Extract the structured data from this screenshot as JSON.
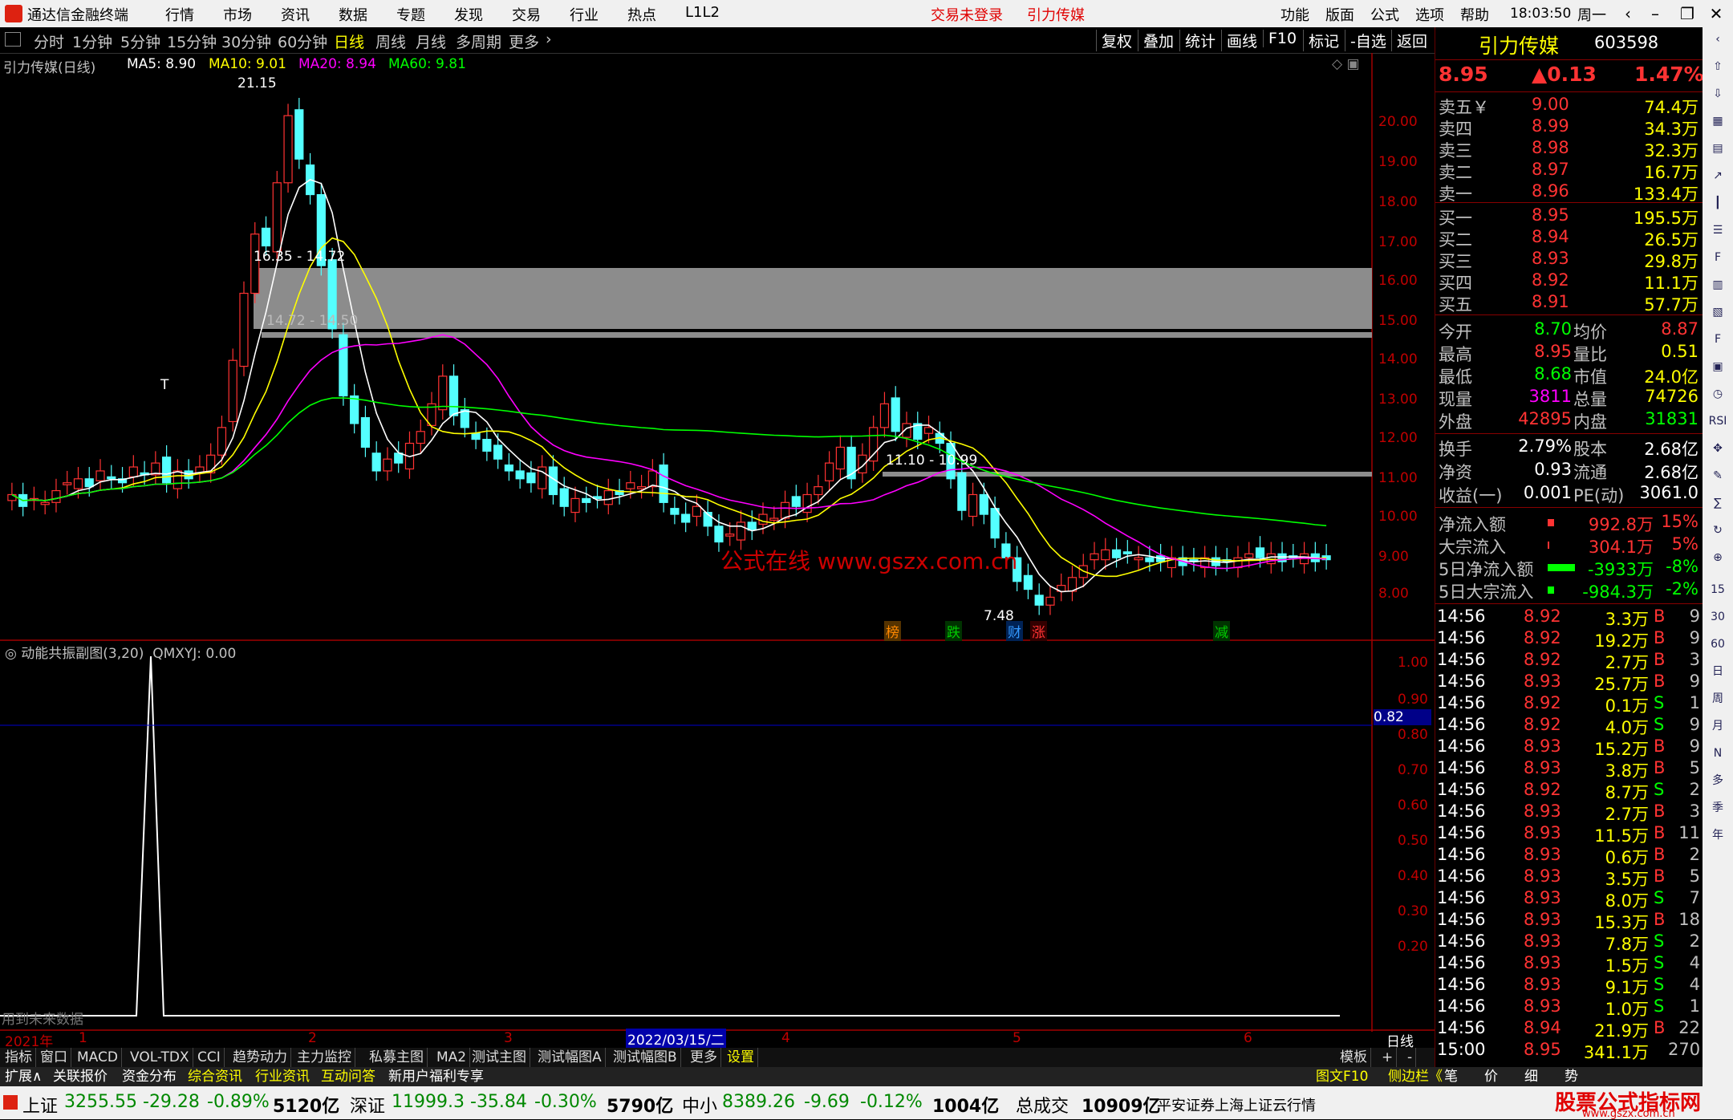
{
  "menubar": {
    "app_name": "通达信金融终端",
    "items": [
      "行情",
      "市场",
      "资讯",
      "数据",
      "专题",
      "发现",
      "交易",
      "行业",
      "热点",
      "L1L2"
    ],
    "login_status": "交易未登录",
    "stock_name_red": "引力传媒",
    "right_items": [
      "功能",
      "版面",
      "公式",
      "选项",
      "帮助"
    ],
    "time": "18:03:50",
    "weekday": "周一"
  },
  "toolbar": {
    "periods": [
      "分时",
      "1分钟",
      "5分钟",
      "15分钟",
      "30分钟",
      "60分钟",
      "日线",
      "周线",
      "月线",
      "多周期",
      "更多"
    ],
    "active_period": "日线",
    "right_buttons": [
      "复权",
      "叠加",
      "统计",
      "画线",
      "F10",
      "标记",
      "-自选",
      "返回"
    ]
  },
  "main_chart": {
    "title": "引力传媒(日线)",
    "ma": [
      {
        "label": "MA5: 8.90",
        "color": "#ffffff"
      },
      {
        "label": "MA10: 9.01",
        "color": "#ffff00"
      },
      {
        "label": "MA20: 8.94",
        "color": "#ff00ff"
      },
      {
        "label": "MA60: 9.81",
        "color": "#00ff00"
      }
    ],
    "y_ticks": [
      "20.00",
      "19.00",
      "18.00",
      "17.00",
      "16.00",
      "15.00",
      "14.00",
      "13.00",
      "12.00",
      "11.00",
      "10.00",
      "9.00",
      "8.00"
    ],
    "annotations": {
      "high": "21.15",
      "low": "7.48",
      "gap1": "16.35 - 14.72",
      "gap2": "14.72 - 14.50",
      "gap3": "11.10 - 10.99",
      "t_mark": "T"
    },
    "watermark": "公式在线   www.gszx.com.cn",
    "event_tags": [
      {
        "text": "榜",
        "color": "#ff8800"
      },
      {
        "text": "跌",
        "color": "#00cc00"
      },
      {
        "text": "财",
        "color": "#3399ff"
      },
      {
        "text": "涨",
        "color": "#ff3333"
      },
      {
        "text": "减",
        "color": "#00cc00"
      }
    ]
  },
  "sub_chart": {
    "title": "动能共振副图(3,20)",
    "value_label": "QMXYJ: 0.00",
    "y_ticks": [
      "1.00",
      "0.90",
      "0.80",
      "0.70",
      "0.60",
      "0.50",
      "0.40",
      "0.30",
      "0.20"
    ],
    "cursor_value": "0.82",
    "future_data_note": "用到未来数据"
  },
  "x_axis": {
    "labels": [
      "2021年",
      "1",
      "2",
      "3",
      "4",
      "5",
      "6"
    ],
    "date_box": "2022/03/15/二",
    "period_label": "日线"
  },
  "quote_panel": {
    "name": "引力传媒",
    "code": "603598",
    "price": "8.95",
    "change": "▲0.13",
    "change_pct": "1.47%",
    "asks": [
      {
        "label": "卖五￥",
        "price": "9.00",
        "vol": "74.4万"
      },
      {
        "label": "卖四",
        "price": "8.99",
        "vol": "34.3万"
      },
      {
        "label": "卖三",
        "price": "8.98",
        "vol": "32.3万"
      },
      {
        "label": "卖二",
        "price": "8.97",
        "vol": "16.7万"
      },
      {
        "label": "卖一",
        "price": "8.96",
        "vol": "133.4万"
      }
    ],
    "bids": [
      {
        "label": "买一",
        "price": "8.95",
        "vol": "195.5万"
      },
      {
        "label": "买二",
        "price": "8.94",
        "vol": "26.5万"
      },
      {
        "label": "买三",
        "price": "8.93",
        "vol": "29.8万"
      },
      {
        "label": "买四",
        "price": "8.92",
        "vol": "11.1万"
      },
      {
        "label": "买五",
        "price": "8.91",
        "vol": "57.7万"
      }
    ],
    "stats": [
      {
        "l1": "今开",
        "v1": "8.70",
        "c1": "#00ff00",
        "l2": "均价",
        "v2": "8.87",
        "c2": "#ff3333"
      },
      {
        "l1": "最高",
        "v1": "8.95",
        "c1": "#ff3333",
        "l2": "量比",
        "v2": "0.51",
        "c2": "#ffff00"
      },
      {
        "l1": "最低",
        "v1": "8.68",
        "c1": "#00ff00",
        "l2": "市值",
        "v2": "24.0亿",
        "c2": "#ffff00"
      },
      {
        "l1": "现量",
        "v1": "3811",
        "c1": "#ff00ff",
        "l2": "总量",
        "v2": "74726",
        "c2": "#ffff00"
      },
      {
        "l1": "外盘",
        "v1": "42895",
        "c1": "#ff3333",
        "l2": "内盘",
        "v2": "31831",
        "c2": "#00ff00"
      }
    ],
    "fundamentals": [
      {
        "l1": "换手",
        "v1": "2.79%",
        "l2": "股本",
        "v2": "2.68亿"
      },
      {
        "l1": "净资",
        "v1": "0.93",
        "l2": "流通",
        "v2": "2.68亿"
      },
      {
        "l1": "收益(一)",
        "v1": "0.001",
        "l2": "PE(动)",
        "v2": "3061.0"
      }
    ],
    "flows": [
      {
        "label": "净流入额",
        "value": "992.8万",
        "pct": "15%",
        "color": "#ff3333",
        "bar": "red-small"
      },
      {
        "label": "大宗流入",
        "value": "304.1万",
        "pct": "5%",
        "color": "#ff3333",
        "bar": "red-tiny"
      },
      {
        "label": "5日净流入额",
        "value": "-3933万",
        "pct": "-8%",
        "color": "#00ff00",
        "bar": "green-long"
      },
      {
        "label": "5日大宗流入",
        "value": "-984.3万",
        "pct": "-2%",
        "color": "#00ff00",
        "bar": "green-small"
      }
    ],
    "ticks": [
      {
        "t": "14:56",
        "p": "8.92",
        "v": "3.3万",
        "d": "B",
        "n": "9"
      },
      {
        "t": "14:56",
        "p": "8.92",
        "v": "19.2万",
        "d": "B",
        "n": "9"
      },
      {
        "t": "14:56",
        "p": "8.92",
        "v": "2.7万",
        "d": "B",
        "n": "3"
      },
      {
        "t": "14:56",
        "p": "8.93",
        "v": "25.7万",
        "d": "B",
        "n": "9"
      },
      {
        "t": "14:56",
        "p": "8.92",
        "v": "0.1万",
        "d": "S",
        "n": "1"
      },
      {
        "t": "14:56",
        "p": "8.92",
        "v": "4.0万",
        "d": "S",
        "n": "9"
      },
      {
        "t": "14:56",
        "p": "8.93",
        "v": "15.2万",
        "d": "B",
        "n": "9"
      },
      {
        "t": "14:56",
        "p": "8.93",
        "v": "3.8万",
        "d": "B",
        "n": "5"
      },
      {
        "t": "14:56",
        "p": "8.92",
        "v": "8.7万",
        "d": "S",
        "n": "2"
      },
      {
        "t": "14:56",
        "p": "8.93",
        "v": "2.7万",
        "d": "B",
        "n": "3"
      },
      {
        "t": "14:56",
        "p": "8.93",
        "v": "11.5万",
        "d": "B",
        "n": "11"
      },
      {
        "t": "14:56",
        "p": "8.93",
        "v": "0.6万",
        "d": "B",
        "n": "2"
      },
      {
        "t": "14:56",
        "p": "8.93",
        "v": "3.5万",
        "d": "B",
        "n": "5"
      },
      {
        "t": "14:56",
        "p": "8.93",
        "v": "8.0万",
        "d": "S",
        "n": "7"
      },
      {
        "t": "14:56",
        "p": "8.93",
        "v": "15.3万",
        "d": "B",
        "n": "18"
      },
      {
        "t": "14:56",
        "p": "8.93",
        "v": "7.8万",
        "d": "S",
        "n": "2"
      },
      {
        "t": "14:56",
        "p": "8.93",
        "v": "1.5万",
        "d": "S",
        "n": "4"
      },
      {
        "t": "14:56",
        "p": "8.93",
        "v": "9.1万",
        "d": "S",
        "n": "4"
      },
      {
        "t": "14:56",
        "p": "8.93",
        "v": "1.0万",
        "d": "S",
        "n": "1"
      },
      {
        "t": "14:56",
        "p": "8.94",
        "v": "21.9万",
        "d": "B",
        "n": "22"
      },
      {
        "t": "15:00",
        "p": "8.95",
        "v": "341.1万",
        "d": "",
        "n": "270"
      }
    ]
  },
  "sidebar_labels": [
    "RSI",
    "15",
    "30",
    "60",
    "日",
    "周",
    "月",
    "N",
    "多",
    "季",
    "年"
  ],
  "bottom_tabs": [
    "指标",
    "窗口",
    "MACD",
    "VOL-TDX",
    "CCI",
    "趋势动力",
    "主力监控",
    "私募主图",
    "MA2",
    "测试主图",
    "测试幅图A",
    "测试幅图B",
    "更多",
    "设置"
  ],
  "bottom_tabs_right": [
    "模板",
    "+",
    "-"
  ],
  "bottom_tabs2": [
    "扩展∧",
    "关联报价",
    "资金分布",
    "综合资讯",
    "行业资讯",
    "互动问答",
    "新用户福利专享"
  ],
  "bottom_tabs2_right": [
    "图文F10",
    "侧边栏《",
    "笔",
    "价",
    "细",
    "势"
  ],
  "statusbar": {
    "sh_label": "上证",
    "sh_val": "3255.55",
    "sh_chg": "-29.28",
    "sh_pct": "-0.89%",
    "sh_amt": "5120亿",
    "sz_label": "深证",
    "sz_val": "11999.3",
    "sz_chg": "-35.84",
    "sz_pct": "-0.30%",
    "sz_amt": "5790亿",
    "zx_label": "中小",
    "zx_val": "8389.26",
    "zx_chg": "-9.69",
    "zx_pct": "-0.12%",
    "zx_amt": "1004亿",
    "total_label": "总成交",
    "total_val": "10909亿",
    "broker": "平安证券上海上证云行情",
    "brand": "股票公式指标网",
    "brand_url": "www.gszx.com.cn"
  }
}
